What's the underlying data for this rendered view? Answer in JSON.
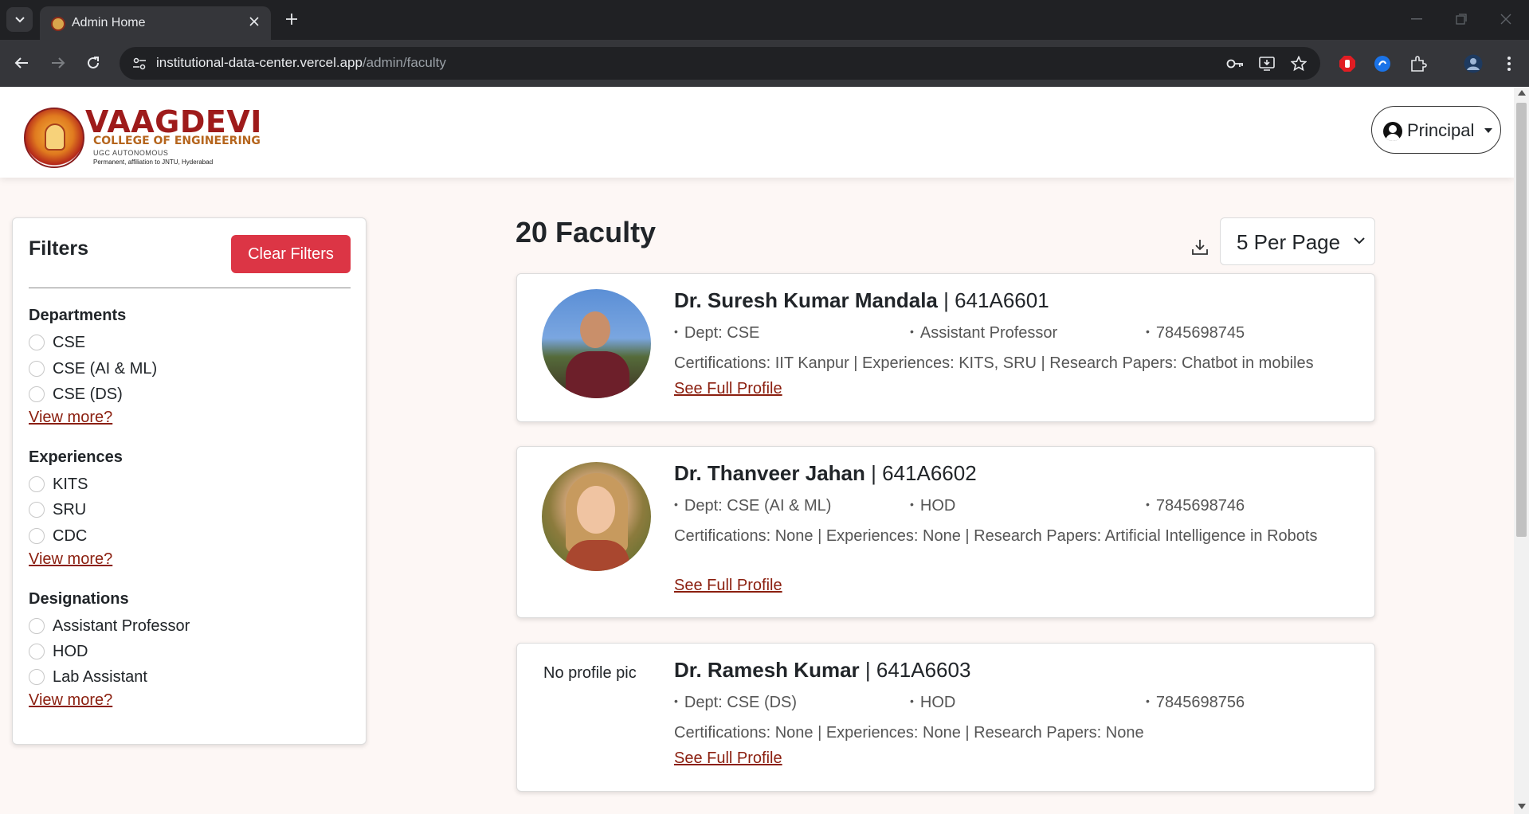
{
  "browser": {
    "tab_title": "Admin Home",
    "url_host": "institutional-data-center.vercel.app",
    "url_path": "/admin/faculty"
  },
  "header": {
    "logo_title": "VAAGDEVI",
    "logo_subtitle": "COLLEGE OF ENGINEERING",
    "logo_autonomous": "UGC AUTONOMOUS",
    "logo_affiliation": "Permanent, affiliation to JNTU, Hyderabad",
    "role_label": "Principal"
  },
  "filters": {
    "title": "Filters",
    "clear_label": "Clear Filters",
    "groups": [
      {
        "title": "Departments",
        "options": [
          "CSE",
          "CSE (AI & ML)",
          "CSE (DS)"
        ],
        "view_more": "View more?"
      },
      {
        "title": "Experiences",
        "options": [
          "KITS",
          "SRU",
          "CDC"
        ],
        "view_more": "View more?"
      },
      {
        "title": "Designations",
        "options": [
          "Assistant Professor",
          "HOD",
          "Lab Assistant"
        ],
        "view_more": "View more?"
      }
    ]
  },
  "results": {
    "title": "20 Faculty",
    "per_page": "5 Per Page",
    "faculty": [
      {
        "name": "Dr. Suresh Kumar Mandala",
        "id": " | 641A6601",
        "dept": "Dept: CSE",
        "designation": "Assistant Professor",
        "phone": "7845698745",
        "summary": "Certifications: IIT Kanpur | Experiences: KITS, SRU | Research Papers: Chatbot in mobiles",
        "link": "See Full Profile"
      },
      {
        "name": "Dr. Thanveer Jahan",
        "id": " | 641A6602",
        "dept": "Dept: CSE (AI & ML)",
        "designation": "HOD",
        "phone": "7845698746",
        "summary": "Certifications: None | Experiences: None | Research Papers: Artificial Intelligence in Robots",
        "link": "See Full Profile"
      },
      {
        "name": "Dr. Ramesh Kumar",
        "id": " | 641A6603",
        "dept": "Dept: CSE (DS)",
        "designation": "HOD",
        "phone": "7845698756",
        "summary": "Certifications: None | Experiences: None | Research Papers: None",
        "photo_alt": "No profile pic",
        "link": "See Full Profile"
      }
    ]
  }
}
